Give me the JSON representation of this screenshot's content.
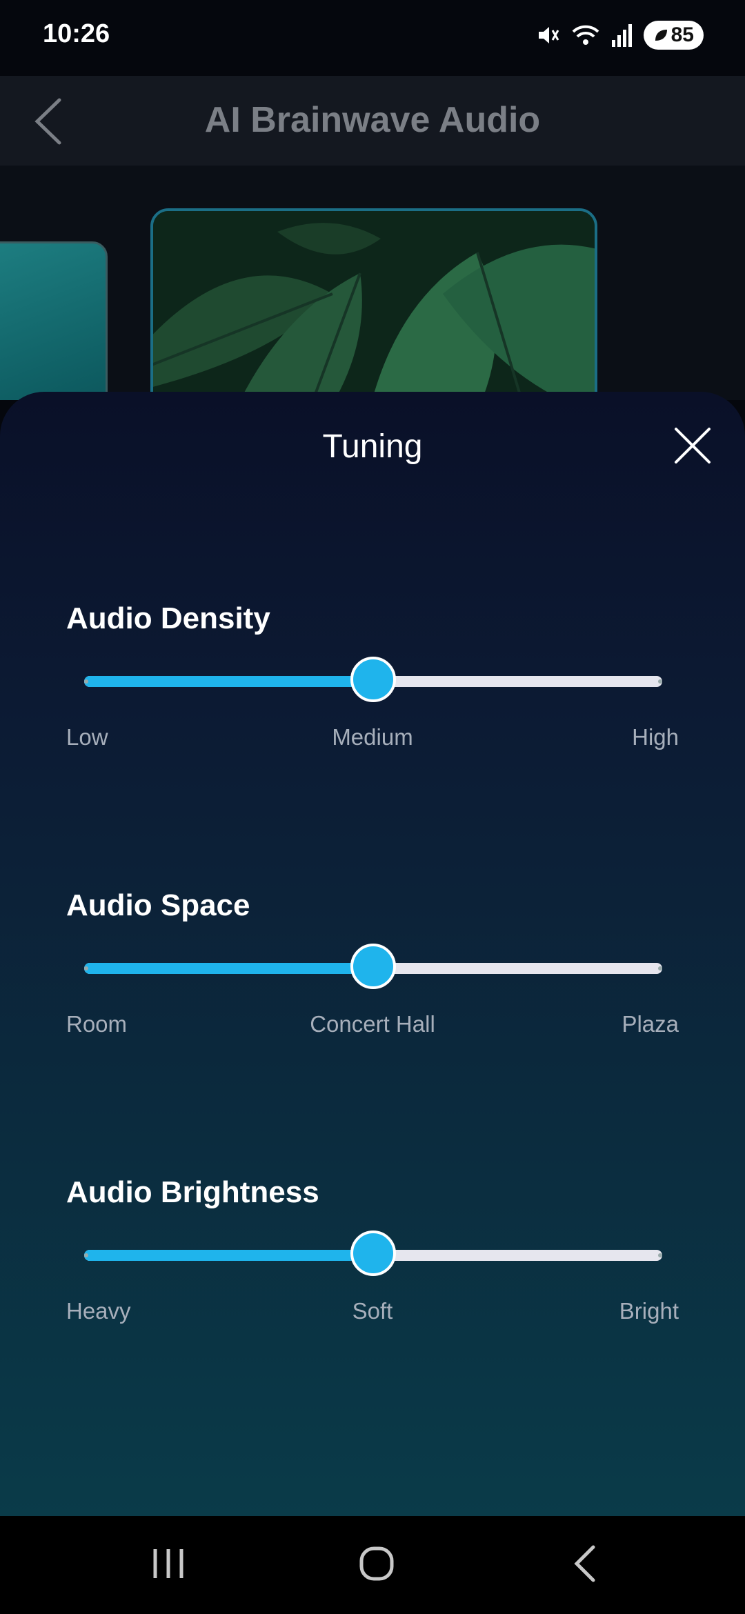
{
  "status_bar": {
    "time": "10:26",
    "battery_level": "85",
    "icons": [
      "mute-icon",
      "wifi-icon",
      "signal-icon",
      "battery-icon"
    ]
  },
  "header": {
    "title": "AI Brainwave Audio",
    "back_icon": "chevron-left-icon"
  },
  "carousel": {
    "cards": [
      "ocean-water-image",
      "tropical-leaves-image"
    ]
  },
  "sheet": {
    "title": "Tuning",
    "close_icon": "close-icon",
    "sections": [
      {
        "title": "Audio Density",
        "labels": [
          "Low",
          "Medium",
          "High"
        ],
        "value": 0.5
      },
      {
        "title": "Audio Space",
        "labels": [
          "Room",
          "Concert Hall",
          "Plaza"
        ],
        "value": 0.5
      },
      {
        "title": "Audio Brightness",
        "labels": [
          "Heavy",
          "Soft",
          "Bright"
        ],
        "value": 0.5
      }
    ]
  },
  "nav_bar": {
    "icons": [
      "recents-icon",
      "home-icon",
      "back-icon"
    ]
  },
  "colors": {
    "accent": "#1fb4ec",
    "track": "#e6e6ee",
    "label": "#a7afbb"
  }
}
